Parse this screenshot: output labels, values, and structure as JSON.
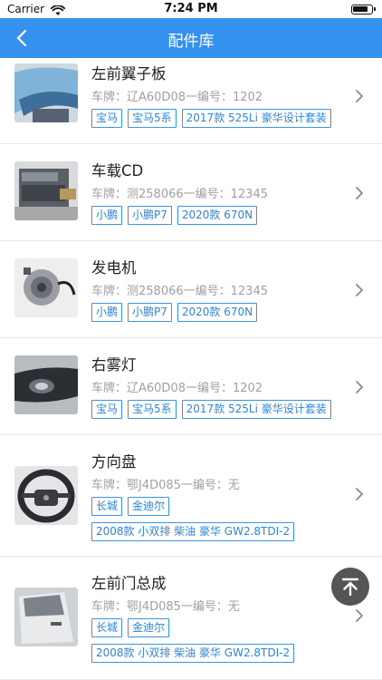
{
  "status_bar": {
    "carrier": "Carrier",
    "time": "7:24 PM"
  },
  "nav": {
    "title": "配件库",
    "back_icon": "chevron-left-icon"
  },
  "parts": [
    {
      "name": "左前翼子板",
      "meta": "车牌：辽A60D08一编号：1202",
      "tags": [
        "宝马",
        "宝马5系",
        "2017款 525Li 豪华设计套装"
      ]
    },
    {
      "name": "车载CD",
      "meta": "车牌：测258066一编号：12345",
      "tags": [
        "小鹏",
        "小鹏P7",
        "2020款 670N"
      ]
    },
    {
      "name": "发电机",
      "meta": "车牌：测258066一编号：12345",
      "tags": [
        "小鹏",
        "小鹏P7",
        "2020款 670N"
      ]
    },
    {
      "name": "右雾灯",
      "meta": "车牌：辽A60D08一编号：1202",
      "tags": [
        "宝马",
        "宝马5系",
        "2017款 525Li 豪华设计套装"
      ]
    },
    {
      "name": "方向盘",
      "meta": "车牌：鄂J4D085一编号：无",
      "tags": [
        "长城",
        "金迪尔"
      ],
      "tags2": [
        "2008款 小双排 柴油 豪华 GW2.8TDI-2"
      ]
    },
    {
      "name": "左前门总成",
      "meta": "车牌：鄂J4D085一编号：无",
      "tags": [
        "长城",
        "金迪尔"
      ],
      "tags2": [
        "2008款 小双排 柴油 豪华 GW2.8TDI-2"
      ]
    }
  ],
  "colors": {
    "nav_blue": "#3591ee",
    "tag_blue": "#2c86d8",
    "meta_gray": "#a0a0a0"
  },
  "scroll_top_icon": "arrow-up-to-top-icon"
}
